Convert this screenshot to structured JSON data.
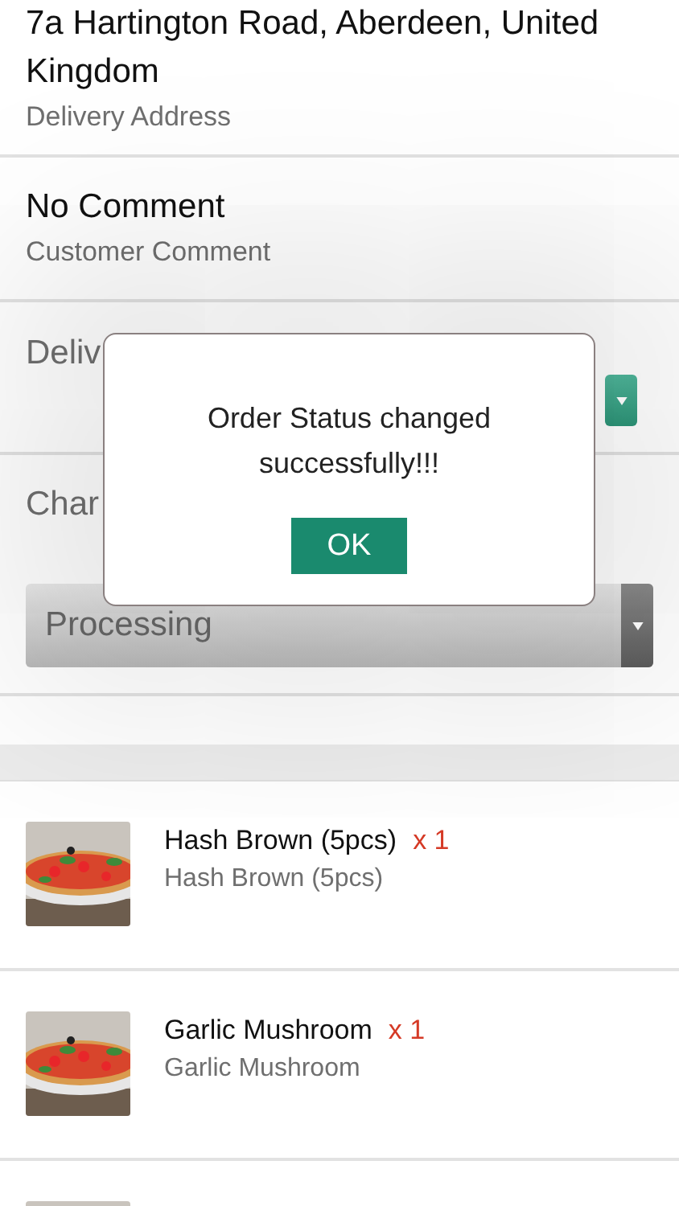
{
  "address": {
    "value": "7a Hartington Road, Aberdeen, United Kingdom",
    "label": "Delivery Address"
  },
  "comment": {
    "value": "No Comment",
    "label": "Customer Comment"
  },
  "delivery_time": {
    "label": "Deliv"
  },
  "status": {
    "label": "Char",
    "value": "Processing"
  },
  "items": [
    {
      "kind": "full",
      "name": "Hash Brown (5pcs)",
      "qty": "x 1",
      "description": "Hash Brown (5pcs)"
    },
    {
      "kind": "full",
      "name": "Garlic Mushroom",
      "qty": "x 1",
      "description": "Garlic Mushroom"
    },
    {
      "kind": "picture"
    }
  ],
  "dialog": {
    "message": "Order Status changed successfully!!!",
    "button": "OK"
  }
}
